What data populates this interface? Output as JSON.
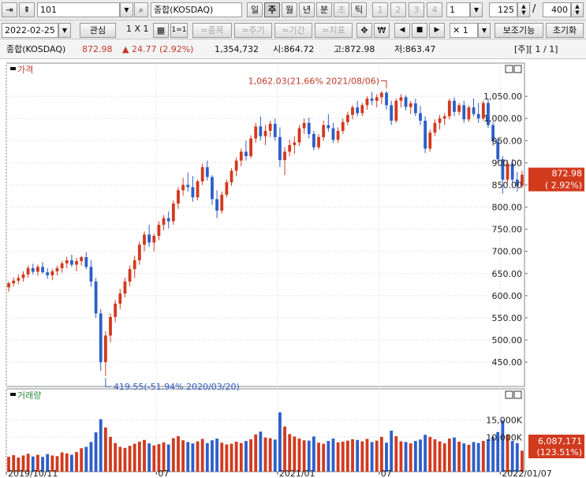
{
  "toolbar1": {
    "code": "101",
    "name": "종합(KOSDAQ)",
    "periods": [
      {
        "label": "일",
        "state": "normal"
      },
      {
        "label": "주",
        "state": "active"
      },
      {
        "label": "월",
        "state": "normal"
      },
      {
        "label": "년",
        "state": "normal"
      },
      {
        "label": "분",
        "state": "normal"
      },
      {
        "label": "초",
        "state": "disabled"
      },
      {
        "label": "틱",
        "state": "normal"
      },
      {
        "label": "1",
        "state": "disabled"
      },
      {
        "label": "2",
        "state": "disabled"
      },
      {
        "label": "3",
        "state": "disabled"
      },
      {
        "label": "4",
        "state": "disabled"
      }
    ],
    "interval_value": "1",
    "count_value": "125",
    "slash": "/",
    "total_value": "400"
  },
  "toolbar2": {
    "date": "2022-02-25",
    "interest_label": "관심",
    "layout_label": "1 X 1",
    "grid_one_label": "1=1",
    "item_label": "=종목",
    "cycle_label": "=주기",
    "period_label": "=기간",
    "indicator_label": "=지표",
    "move_glyph": "✥",
    "won_glyph": "₩",
    "prev_glyph": "◀",
    "stop_glyph": "■",
    "next_glyph": "▶",
    "cross_glyph": "✕",
    "multiplier": "1",
    "aux_label": "보조기능",
    "reset_label": "초기화"
  },
  "title_bar": {
    "name": "종합(KOSDAQ)",
    "price": "872.98",
    "change": "▲ 24.77 (2.92%)",
    "volume": "1,354,732",
    "open": "시:864.72",
    "high": "고:872.98",
    "low": "저:863.47",
    "page_info": "[주][ 1 / 1]"
  },
  "colors": {
    "up": "#d23a1e",
    "down": "#2d5fc9",
    "label_bg": "#d23a1e",
    "annot": "#2d5fc9",
    "annot_high": "#c0392b",
    "vol_label": "#2a8a3a"
  },
  "chart_data": {
    "type": "candlestick",
    "price_panel": {
      "label": "가격",
      "y_ticks": [
        450,
        500,
        550,
        600,
        650,
        700,
        750,
        800,
        850,
        900,
        950,
        1000,
        1050
      ],
      "y_tick_labels": [
        "450.00",
        "500.00",
        "550.00",
        "600.00",
        "650.00",
        "700.00",
        "750.00",
        "800.00",
        "850.00",
        "900.00",
        "950.00",
        "1,000.00",
        "1,050.00"
      ],
      "ylim": [
        395,
        1125
      ],
      "current_label": "872.98",
      "current_change_label": "( 2.92%)",
      "current_value": 872.98,
      "annotation_high": {
        "text": "1,062.03(21.66% 2021/08/06)",
        "value": 1062.03,
        "index": 78
      },
      "annotation_low": {
        "text": "419.55(-51.94% 2020/03/20)",
        "value": 419.55,
        "index": 20
      }
    },
    "volume_panel": {
      "label": "거래량",
      "y_tick_labels": [
        "15,000K",
        "10,000K"
      ],
      "y_ticks": [
        15000,
        10000
      ],
      "ylim": [
        0,
        24000
      ],
      "current_label": "6,087,171",
      "current_change_label": "(123.51%)"
    },
    "x_tick_labels": [
      {
        "text": "2019/10/11",
        "index": 0
      },
      {
        "text": "07",
        "index": 31
      },
      {
        "text": "2021/01",
        "index": 56
      },
      {
        "text": "07",
        "index": 77
      },
      {
        "text": "2022/01/07",
        "index": 102
      }
    ],
    "candle_count": 107,
    "candles": [
      [
        619,
        632,
        609,
        628,
        4300
      ],
      [
        628,
        641,
        621,
        634,
        4800
      ],
      [
        634,
        648,
        626,
        640,
        4100
      ],
      [
        640,
        655,
        632,
        648,
        4700
      ],
      [
        648,
        668,
        641,
        662,
        5200
      ],
      [
        662,
        672,
        648,
        654,
        4400
      ],
      [
        654,
        670,
        645,
        665,
        4900
      ],
      [
        665,
        676,
        649,
        653,
        4300
      ],
      [
        653,
        662,
        638,
        646,
        5100
      ],
      [
        646,
        660,
        635,
        655,
        4700
      ],
      [
        655,
        668,
        646,
        662,
        4500
      ],
      [
        662,
        678,
        652,
        673,
        5600
      ],
      [
        673,
        688,
        662,
        680,
        5300
      ],
      [
        680,
        693,
        665,
        670,
        4900
      ],
      [
        670,
        685,
        655,
        678,
        5700
      ],
      [
        678,
        690,
        668,
        687,
        6800
      ],
      [
        687,
        698,
        660,
        665,
        7200
      ],
      [
        665,
        680,
        620,
        632,
        8600
      ],
      [
        632,
        640,
        550,
        560,
        11400
      ],
      [
        560,
        570,
        430,
        450,
        15200
      ],
      [
        450,
        520,
        419,
        510,
        12800
      ],
      [
        510,
        560,
        495,
        552,
        10100
      ],
      [
        552,
        590,
        540,
        582,
        8300
      ],
      [
        582,
        615,
        570,
        605,
        7200
      ],
      [
        605,
        640,
        596,
        632,
        6900
      ],
      [
        632,
        668,
        622,
        660,
        7500
      ],
      [
        660,
        690,
        640,
        680,
        8100
      ],
      [
        680,
        722,
        670,
        715,
        8700
      ],
      [
        715,
        745,
        700,
        738,
        9200
      ],
      [
        738,
        760,
        710,
        720,
        8200
      ],
      [
        720,
        740,
        700,
        735,
        7600
      ],
      [
        735,
        768,
        725,
        760,
        8000
      ],
      [
        760,
        782,
        748,
        775,
        8500
      ],
      [
        775,
        790,
        752,
        768,
        7900
      ],
      [
        768,
        815,
        760,
        808,
        9700
      ],
      [
        808,
        845,
        796,
        838,
        10300
      ],
      [
        838,
        866,
        826,
        850,
        9100
      ],
      [
        850,
        878,
        835,
        845,
        8600
      ],
      [
        845,
        870,
        812,
        822,
        8200
      ],
      [
        822,
        862,
        815,
        858,
        8800
      ],
      [
        858,
        898,
        850,
        890,
        9500
      ],
      [
        890,
        905,
        860,
        868,
        8300
      ],
      [
        868,
        872,
        805,
        818,
        9100
      ],
      [
        818,
        838,
        775,
        792,
        9600
      ],
      [
        792,
        835,
        785,
        828,
        8400
      ],
      [
        828,
        862,
        822,
        856,
        7900
      ],
      [
        856,
        888,
        848,
        882,
        8100
      ],
      [
        882,
        912,
        870,
        905,
        8700
      ],
      [
        905,
        932,
        892,
        925,
        8300
      ],
      [
        925,
        950,
        905,
        915,
        8900
      ],
      [
        915,
        962,
        910,
        955,
        9400
      ],
      [
        955,
        990,
        945,
        982,
        10800
      ],
      [
        982,
        1005,
        950,
        960,
        11600
      ],
      [
        960,
        985,
        940,
        972,
        9900
      ],
      [
        972,
        995,
        958,
        988,
        9700
      ],
      [
        988,
        1000,
        950,
        958,
        9300
      ],
      [
        958,
        980,
        890,
        906,
        17200
      ],
      [
        906,
        935,
        872,
        925,
        13100
      ],
      [
        925,
        952,
        915,
        940,
        10900
      ],
      [
        940,
        960,
        920,
        946,
        10200
      ],
      [
        946,
        985,
        938,
        978,
        9600
      ],
      [
        978,
        1000,
        965,
        990,
        9100
      ],
      [
        990,
        1002,
        955,
        965,
        9000
      ],
      [
        965,
        972,
        928,
        935,
        10200
      ],
      [
        935,
        965,
        930,
        958,
        8400
      ],
      [
        958,
        995,
        950,
        985,
        8100
      ],
      [
        985,
        1010,
        970,
        978,
        8900
      ],
      [
        978,
        990,
        945,
        952,
        9600
      ],
      [
        952,
        980,
        945,
        972,
        8500
      ],
      [
        972,
        1000,
        965,
        992,
        8700
      ],
      [
        992,
        1015,
        985,
        1008,
        9000
      ],
      [
        1008,
        1030,
        998,
        1025,
        9400
      ],
      [
        1025,
        1040,
        1005,
        1012,
        9200
      ],
      [
        1012,
        1035,
        1005,
        1030,
        8800
      ],
      [
        1030,
        1050,
        1020,
        1045,
        9500
      ],
      [
        1045,
        1060,
        1030,
        1040,
        8600
      ],
      [
        1040,
        1055,
        1025,
        1048,
        9000
      ],
      [
        1048,
        1062,
        1032,
        1058,
        10100
      ],
      [
        1058,
        1062,
        1020,
        1030,
        8400
      ],
      [
        1030,
        1040,
        985,
        995,
        11900
      ],
      [
        995,
        1045,
        990,
        1040,
        10300
      ],
      [
        1040,
        1055,
        1025,
        1048,
        8800
      ],
      [
        1048,
        1052,
        1018,
        1026,
        8600
      ],
      [
        1026,
        1040,
        1010,
        1034,
        8200
      ],
      [
        1034,
        1045,
        1005,
        1012,
        8900
      ],
      [
        1012,
        1028,
        985,
        995,
        9300
      ],
      [
        995,
        1005,
        922,
        932,
        10700
      ],
      [
        932,
        975,
        925,
        968,
        10100
      ],
      [
        968,
        998,
        960,
        990,
        9400
      ],
      [
        990,
        1008,
        975,
        1000,
        8800
      ],
      [
        1000,
        1012,
        985,
        1005,
        8200
      ],
      [
        1005,
        1045,
        998,
        1040,
        9600
      ],
      [
        1040,
        1048,
        1005,
        1015,
        9900
      ],
      [
        1015,
        1035,
        1008,
        1030,
        8700
      ],
      [
        1030,
        1040,
        990,
        998,
        8200
      ],
      [
        998,
        1030,
        992,
        1025,
        7800
      ],
      [
        1025,
        1045,
        1005,
        1010,
        8600
      ],
      [
        1010,
        1035,
        990,
        1000,
        8300
      ],
      [
        1000,
        1040,
        995,
        1035,
        8900
      ],
      [
        1035,
        1045,
        978,
        985,
        9400
      ],
      [
        985,
        992,
        938,
        948,
        10100
      ],
      [
        948,
        955,
        900,
        908,
        11500
      ],
      [
        908,
        915,
        830,
        862,
        14800
      ],
      [
        862,
        905,
        855,
        898,
        10700
      ],
      [
        898,
        908,
        856,
        862,
        8900
      ],
      [
        862,
        880,
        835,
        848,
        8300
      ],
      [
        848,
        882,
        843,
        872.98,
        6087
      ]
    ]
  }
}
